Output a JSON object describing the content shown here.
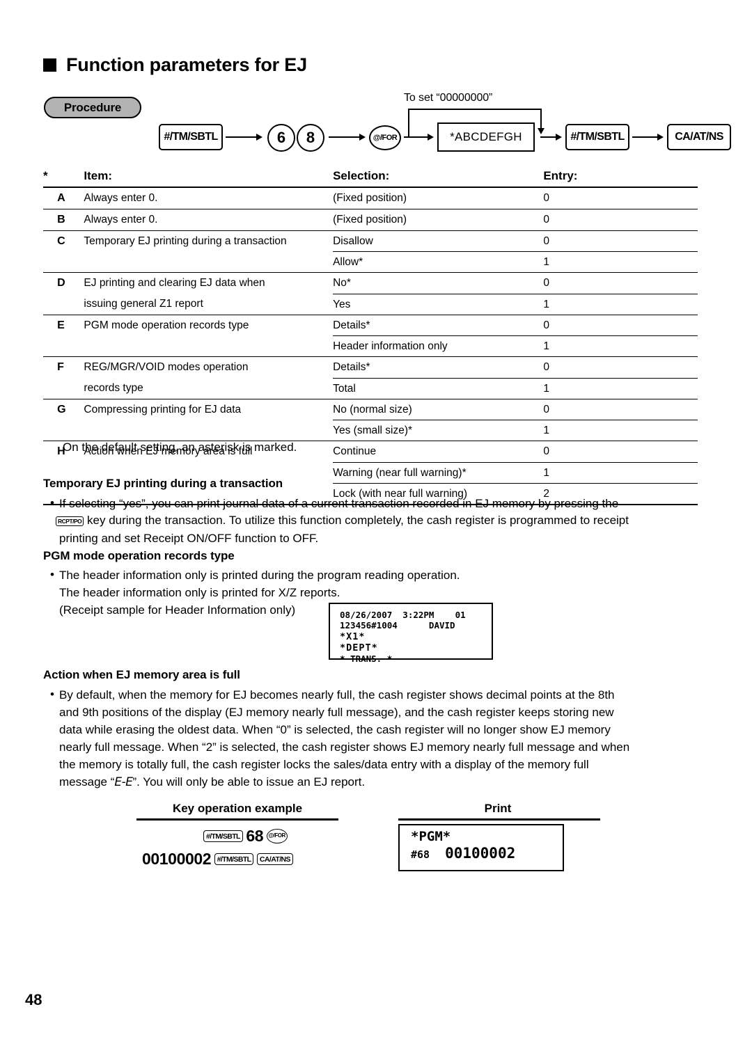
{
  "page": {
    "number": "48",
    "heading": "Function parameters for EJ",
    "procedure_badge": "Procedure"
  },
  "procedure_flow": {
    "to_set_label": "To set “00000000”",
    "steps": [
      {
        "id": "tm-sbtl-1",
        "label": "#/TM/SBTL",
        "shape": "rect"
      },
      {
        "id": "digit-6",
        "label": "6",
        "shape": "circle"
      },
      {
        "id": "digit-8",
        "label": "8",
        "shape": "circle"
      },
      {
        "id": "at-for",
        "label": "@/FOR",
        "shape": "circle"
      },
      {
        "id": "abcdefgh",
        "label": "*ABCDEFGH",
        "shape": "plain-rect"
      },
      {
        "id": "tm-sbtl-2",
        "label": "#/TM/SBTL",
        "shape": "rect"
      },
      {
        "id": "ca-at-ns",
        "label": "CA/AT/NS",
        "shape": "rect"
      }
    ]
  },
  "table": {
    "star": "*",
    "headers": {
      "item": "Item:",
      "selection": "Selection:",
      "entry": "Entry:"
    },
    "rows": [
      {
        "letter": "A",
        "item": "Always enter 0.",
        "options": [
          {
            "selection": "(Fixed position)",
            "entry": "0"
          }
        ]
      },
      {
        "letter": "B",
        "item": "Always enter 0.",
        "options": [
          {
            "selection": "(Fixed position)",
            "entry": "0"
          }
        ]
      },
      {
        "letter": "C",
        "item": "Temporary EJ printing during a transaction",
        "options": [
          {
            "selection": "Disallow",
            "entry": "0"
          },
          {
            "selection": "Allow*",
            "entry": "1"
          }
        ]
      },
      {
        "letter": "D",
        "item": "EJ printing and clearing EJ data when",
        "item2": "issuing general Z1 report",
        "options": [
          {
            "selection": "No*",
            "entry": "0"
          },
          {
            "selection": "Yes",
            "entry": "1"
          }
        ]
      },
      {
        "letter": "E",
        "item": "PGM mode operation records type",
        "options": [
          {
            "selection": "Details*",
            "entry": "0"
          },
          {
            "selection": "Header information only",
            "entry": "1"
          }
        ]
      },
      {
        "letter": "F",
        "item": "REG/MGR/VOID modes operation",
        "item2": "records type",
        "options": [
          {
            "selection": "Details*",
            "entry": "0"
          },
          {
            "selection": "Total",
            "entry": "1"
          }
        ]
      },
      {
        "letter": "G",
        "item": "Compressing printing for EJ data",
        "options": [
          {
            "selection": "No (normal size)",
            "entry": "0"
          },
          {
            "selection": "Yes (small size)*",
            "entry": "1"
          }
        ]
      },
      {
        "letter": "H",
        "item": "Action when EJ memory area is full",
        "options": [
          {
            "selection": "Continue",
            "entry": "0"
          },
          {
            "selection": "Warning (near full warning)*",
            "entry": "1"
          },
          {
            "selection": "Lock (with near full warning)",
            "entry": "2"
          }
        ]
      }
    ],
    "footnote": "On the default setting, an asterisk is marked."
  },
  "sections": {
    "temporary_ej": {
      "title": "Temporary EJ printing during a transaction",
      "bullet": "•",
      "line1": "If selecting “yes”, you can print journal data of a current transaction recorded in EJ memory by pressing the",
      "key_label": "RCPT/PO",
      "line2_after_key": "key during the transaction.  To utilize this function completely, the cash register is programmed to receipt",
      "line3": "printing and set Receipt ON/OFF function to OFF."
    },
    "pgm_records": {
      "title": "PGM mode operation records type",
      "bullet": "•",
      "line1": "The header information only is printed during the program reading operation.",
      "line2": "The header information only is printed for X/Z reports.",
      "line3": "(Receipt sample for Header Information only)"
    },
    "memory_full": {
      "title": "Action when EJ memory area is full",
      "bullet": "•",
      "line1": "By default, when the memory for EJ becomes nearly full, the cash register shows decimal points at the 8th",
      "line2": "and 9th positions of the display (EJ memory nearly full message), and the cash register keeps storing new",
      "line3": "data while erasing the oldest data.  When “0” is selected, the cash register will no longer show EJ memory",
      "line4": "nearly full message.  When “2” is selected, the cash register shows EJ memory nearly full message and when",
      "line5": "the memory is totally full, the cash register locks the sales/data entry with a display of the memory full",
      "line6_pre": "message “",
      "line6_glyph": "E-E",
      "line6_post": "”.  You will only be able to issue an EJ report."
    }
  },
  "receipt_sample": {
    "line1": "08/26/2007  3:22PM    01",
    "line2": "123456#1004      DAVID",
    "line3": "*X1*",
    "line4": "*DEPT*",
    "line5": "* TRANS. *"
  },
  "bottom": {
    "key_operation_title": "Key operation example",
    "print_title": "Print",
    "key_row1": {
      "key1": "#/TM/SBTL",
      "number": "68",
      "key2": "@/FOR"
    },
    "key_row2": {
      "number": "00100002",
      "key1": "#/TM/SBTL",
      "key2": "CA/AT/NS"
    },
    "print_sample": {
      "line1": "*PGM*",
      "line2_label": "#68",
      "line2_value": "00100002"
    }
  }
}
